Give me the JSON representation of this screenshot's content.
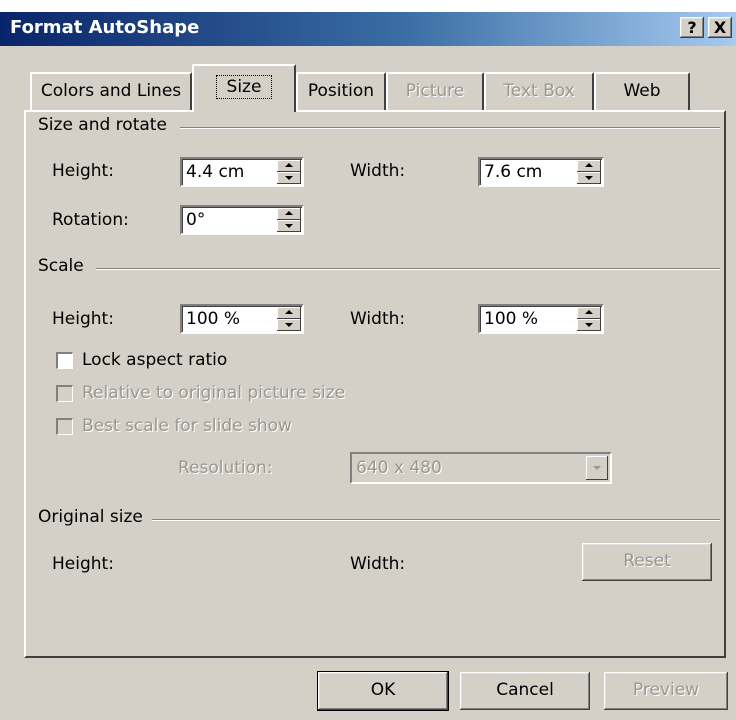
{
  "window": {
    "title": "Format AutoShape",
    "help_glyph": "?",
    "close_glyph": "X"
  },
  "tabs": [
    {
      "label": "Colors and Lines",
      "active": false,
      "disabled": false
    },
    {
      "label": "Size",
      "active": true,
      "disabled": false
    },
    {
      "label": "Position",
      "active": false,
      "disabled": false
    },
    {
      "label": "Picture",
      "active": false,
      "disabled": true
    },
    {
      "label": "Text Box",
      "active": false,
      "disabled": true
    },
    {
      "label": "Web",
      "active": false,
      "disabled": false
    }
  ],
  "size_rotate": {
    "group_label": "Size and rotate",
    "height_label": "Height:",
    "height_value": "4.4 cm",
    "width_label": "Width:",
    "width_value": "7.6 cm",
    "rotation_label": "Rotation:",
    "rotation_value": "0°"
  },
  "scale": {
    "group_label": "Scale",
    "height_label": "Height:",
    "height_value": "100 %",
    "width_label": "Width:",
    "width_value": "100 %",
    "lock_aspect_label": "Lock aspect ratio",
    "lock_aspect_checked": false,
    "relative_label": "Relative to original picture size",
    "best_scale_label": "Best scale for slide show",
    "resolution_label": "Resolution:",
    "resolution_value": "640 x 480"
  },
  "original_size": {
    "group_label": "Original size",
    "height_label": "Height:",
    "width_label": "Width:",
    "reset_label": "Reset"
  },
  "footer": {
    "ok_label": "OK",
    "cancel_label": "Cancel",
    "preview_label": "Preview"
  },
  "colors": {
    "face": "#d4d0c8",
    "title_start": "#0a246a",
    "title_end": "#a6caf0",
    "disabled_text": "#9a9690"
  }
}
